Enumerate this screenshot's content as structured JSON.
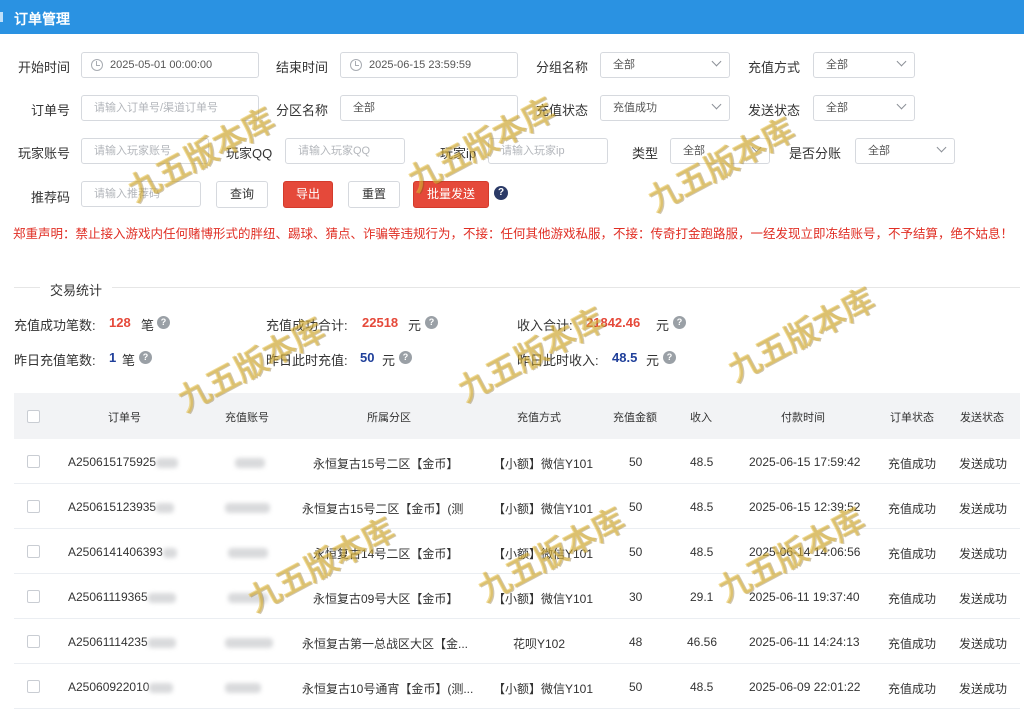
{
  "page": {
    "title": "订单管理"
  },
  "filters": {
    "start_time": {
      "label": "开始时间",
      "value": "2025-05-01 00:00:00"
    },
    "end_time": {
      "label": "结束时间",
      "value": "2025-06-15 23:59:59"
    },
    "group_name": {
      "label": "分组名称",
      "value": "全部"
    },
    "recharge_method": {
      "label": "充值方式",
      "value": "全部"
    },
    "order_no": {
      "label": "订单号",
      "placeholder": "请输入订单号/渠道订单号"
    },
    "zone_name": {
      "label": "分区名称",
      "value": "全部"
    },
    "recharge_status": {
      "label": "充值状态",
      "value": "充值成功"
    },
    "send_status": {
      "label": "发送状态",
      "value": "全部"
    },
    "player_account": {
      "label": "玩家账号",
      "placeholder": "请输入玩家账号"
    },
    "player_qq": {
      "label": "玩家QQ",
      "placeholder": "请输入玩家QQ"
    },
    "player_ip": {
      "label": "玩家ip",
      "placeholder": "请输入玩家ip"
    },
    "type": {
      "label": "类型",
      "value": "全部"
    },
    "split": {
      "label": "是否分账",
      "value": "全部"
    },
    "referral": {
      "label": "推荐码",
      "placeholder": "请输入推荐码"
    }
  },
  "actions": {
    "query": "查询",
    "export": "导出",
    "reset": "重置",
    "batch_send": "批量发送",
    "help": "?"
  },
  "notice": "郑重声明：禁止接入游戏内任何赌博形式的胖纽、踢球、猜点、诈骗等违规行为，不接：任何其他游戏私服，不接：传奇打金跑路服，一经发现立即冻结账号，不予结算，绝不姑息！",
  "stats": {
    "section_title": "交易统计",
    "success_count": {
      "label": "充值成功笔数:",
      "value": "128",
      "unit": "笔"
    },
    "success_total": {
      "label": "充值成功合计:",
      "value": "22518",
      "unit": "元"
    },
    "income_total": {
      "label": "收入合计:",
      "value": "21842.46",
      "unit": "元"
    },
    "yesterday_count": {
      "label": "昨日充值笔数:",
      "value": "1",
      "unit": "笔"
    },
    "yesterday_now_recharge": {
      "label": "昨日此时充值:",
      "value": "50",
      "unit": "元"
    },
    "yesterday_now_income": {
      "label": "昨日此时收入:",
      "value": "48.5",
      "unit": "元"
    }
  },
  "table": {
    "columns": [
      "订单号",
      "充值账号",
      "所属分区",
      "充值方式",
      "充值金额",
      "收入",
      "付款时间",
      "订单状态",
      "发送状态"
    ],
    "rows": [
      {
        "order": "A250615175925",
        "zone": "永恒复古15号二区【金币】",
        "method": "【小额】微信Y101",
        "amount": "50",
        "income": "48.5",
        "time": "2025-06-15 17:59:42",
        "status": "充值成功",
        "send": "发送成功"
      },
      {
        "order": "A250615123935",
        "zone": "永恒复古15号二区【金币】(测",
        "method": "【小额】微信Y101",
        "amount": "50",
        "income": "48.5",
        "time": "2025-06-15 12:39:52",
        "status": "充值成功",
        "send": "发送成功"
      },
      {
        "order": "A2506141406393",
        "zone": "永恒复古14号二区【金币】",
        "method": "【小额】微信Y101",
        "amount": "50",
        "income": "48.5",
        "time": "2025-06-14 14:06:56",
        "status": "充值成功",
        "send": "发送成功"
      },
      {
        "order": "A25061119365",
        "zone": "永恒复古09号大区【金币】",
        "method": "【小额】微信Y101",
        "amount": "30",
        "income": "29.1",
        "time": "2025-06-11 19:37:40",
        "status": "充值成功",
        "send": "发送成功"
      },
      {
        "order": "A25061114235",
        "zone": "永恒复古第一总战区大区【金...",
        "method": "花呗Y102",
        "amount": "48",
        "income": "46.56",
        "time": "2025-06-11 14:24:13",
        "status": "充值成功",
        "send": "发送成功"
      },
      {
        "order": "A25060922010",
        "zone": "永恒复古10号通宵【金币】(测...",
        "method": "【小额】微信Y101",
        "amount": "50",
        "income": "48.5",
        "time": "2025-06-09 22:01:22",
        "status": "充值成功",
        "send": "发送成功"
      }
    ]
  },
  "watermark": {
    "text": "九五版本库",
    "color": "#e6be3c"
  }
}
